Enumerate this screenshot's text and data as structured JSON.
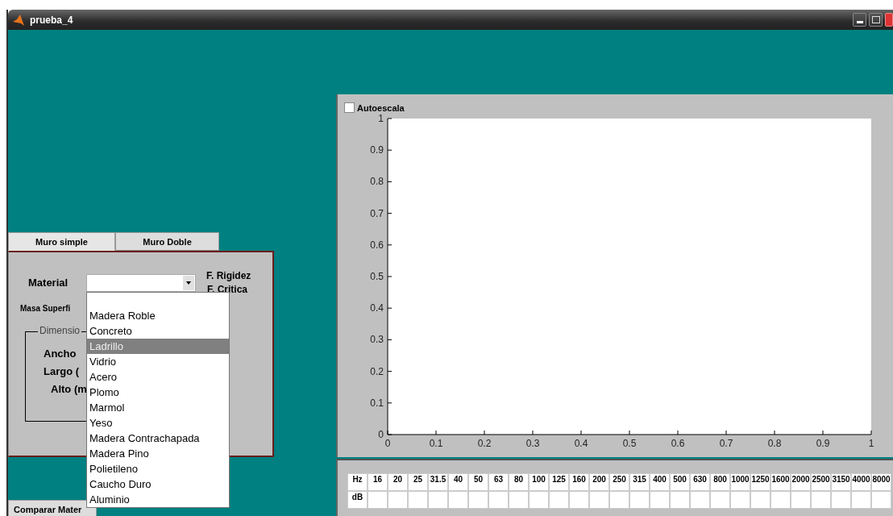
{
  "window": {
    "title": "prueba_4"
  },
  "tabs": [
    {
      "label": "Muro simple",
      "selected": true
    },
    {
      "label": "Muro Doble",
      "selected": false
    }
  ],
  "panel": {
    "material_label": "Material",
    "rigidez_label": "F. Rigidez",
    "critica_label": "F. Critica",
    "masa_label": "Masa Superfi",
    "group_title": "Dimensio",
    "dimension_labels": [
      "Ancho",
      "Largo  (",
      "Alto  (m"
    ]
  },
  "material_list": [
    {
      "label": "Madera Roble",
      "selected": false
    },
    {
      "label": "Concreto",
      "selected": false
    },
    {
      "label": "Ladrillo",
      "selected": true
    },
    {
      "label": "Vidrio",
      "selected": false
    },
    {
      "label": "Acero",
      "selected": false
    },
    {
      "label": "Plomo",
      "selected": false
    },
    {
      "label": "Marmol",
      "selected": false
    },
    {
      "label": "Yeso",
      "selected": false
    },
    {
      "label": "Madera Contrachapada",
      "selected": false
    },
    {
      "label": "Madera Pino",
      "selected": false
    },
    {
      "label": "Polietileno",
      "selected": false
    },
    {
      "label": "Caucho Duro",
      "selected": false
    },
    {
      "label": "Aluminio",
      "selected": false
    }
  ],
  "bottom_tab": {
    "label": "Comparar Mater"
  },
  "autoescala": {
    "label": "Autoescala",
    "checked": false
  },
  "plot": {
    "chart_data": {
      "type": "line",
      "xlim": [
        0,
        1
      ],
      "ylim": [
        0,
        1
      ],
      "xticks": [
        0,
        0.1,
        0.2,
        0.3,
        0.4,
        0.5,
        0.6,
        0.7,
        0.8,
        0.9,
        1
      ],
      "yticks": [
        0,
        0.1,
        0.2,
        0.3,
        0.4,
        0.5,
        0.6,
        0.7,
        0.8,
        0.9,
        1
      ]
    }
  },
  "table": {
    "row_headers": [
      "Hz",
      "dB"
    ],
    "frequencies": [
      "16",
      "20",
      "25",
      "31.5",
      "40",
      "50",
      "63",
      "80",
      "100",
      "125",
      "160",
      "200",
      "250",
      "315",
      "400",
      "500",
      "630",
      "800",
      "1000",
      "1250",
      "1600",
      "2000",
      "2500",
      "3150",
      "4000",
      "8000"
    ]
  }
}
